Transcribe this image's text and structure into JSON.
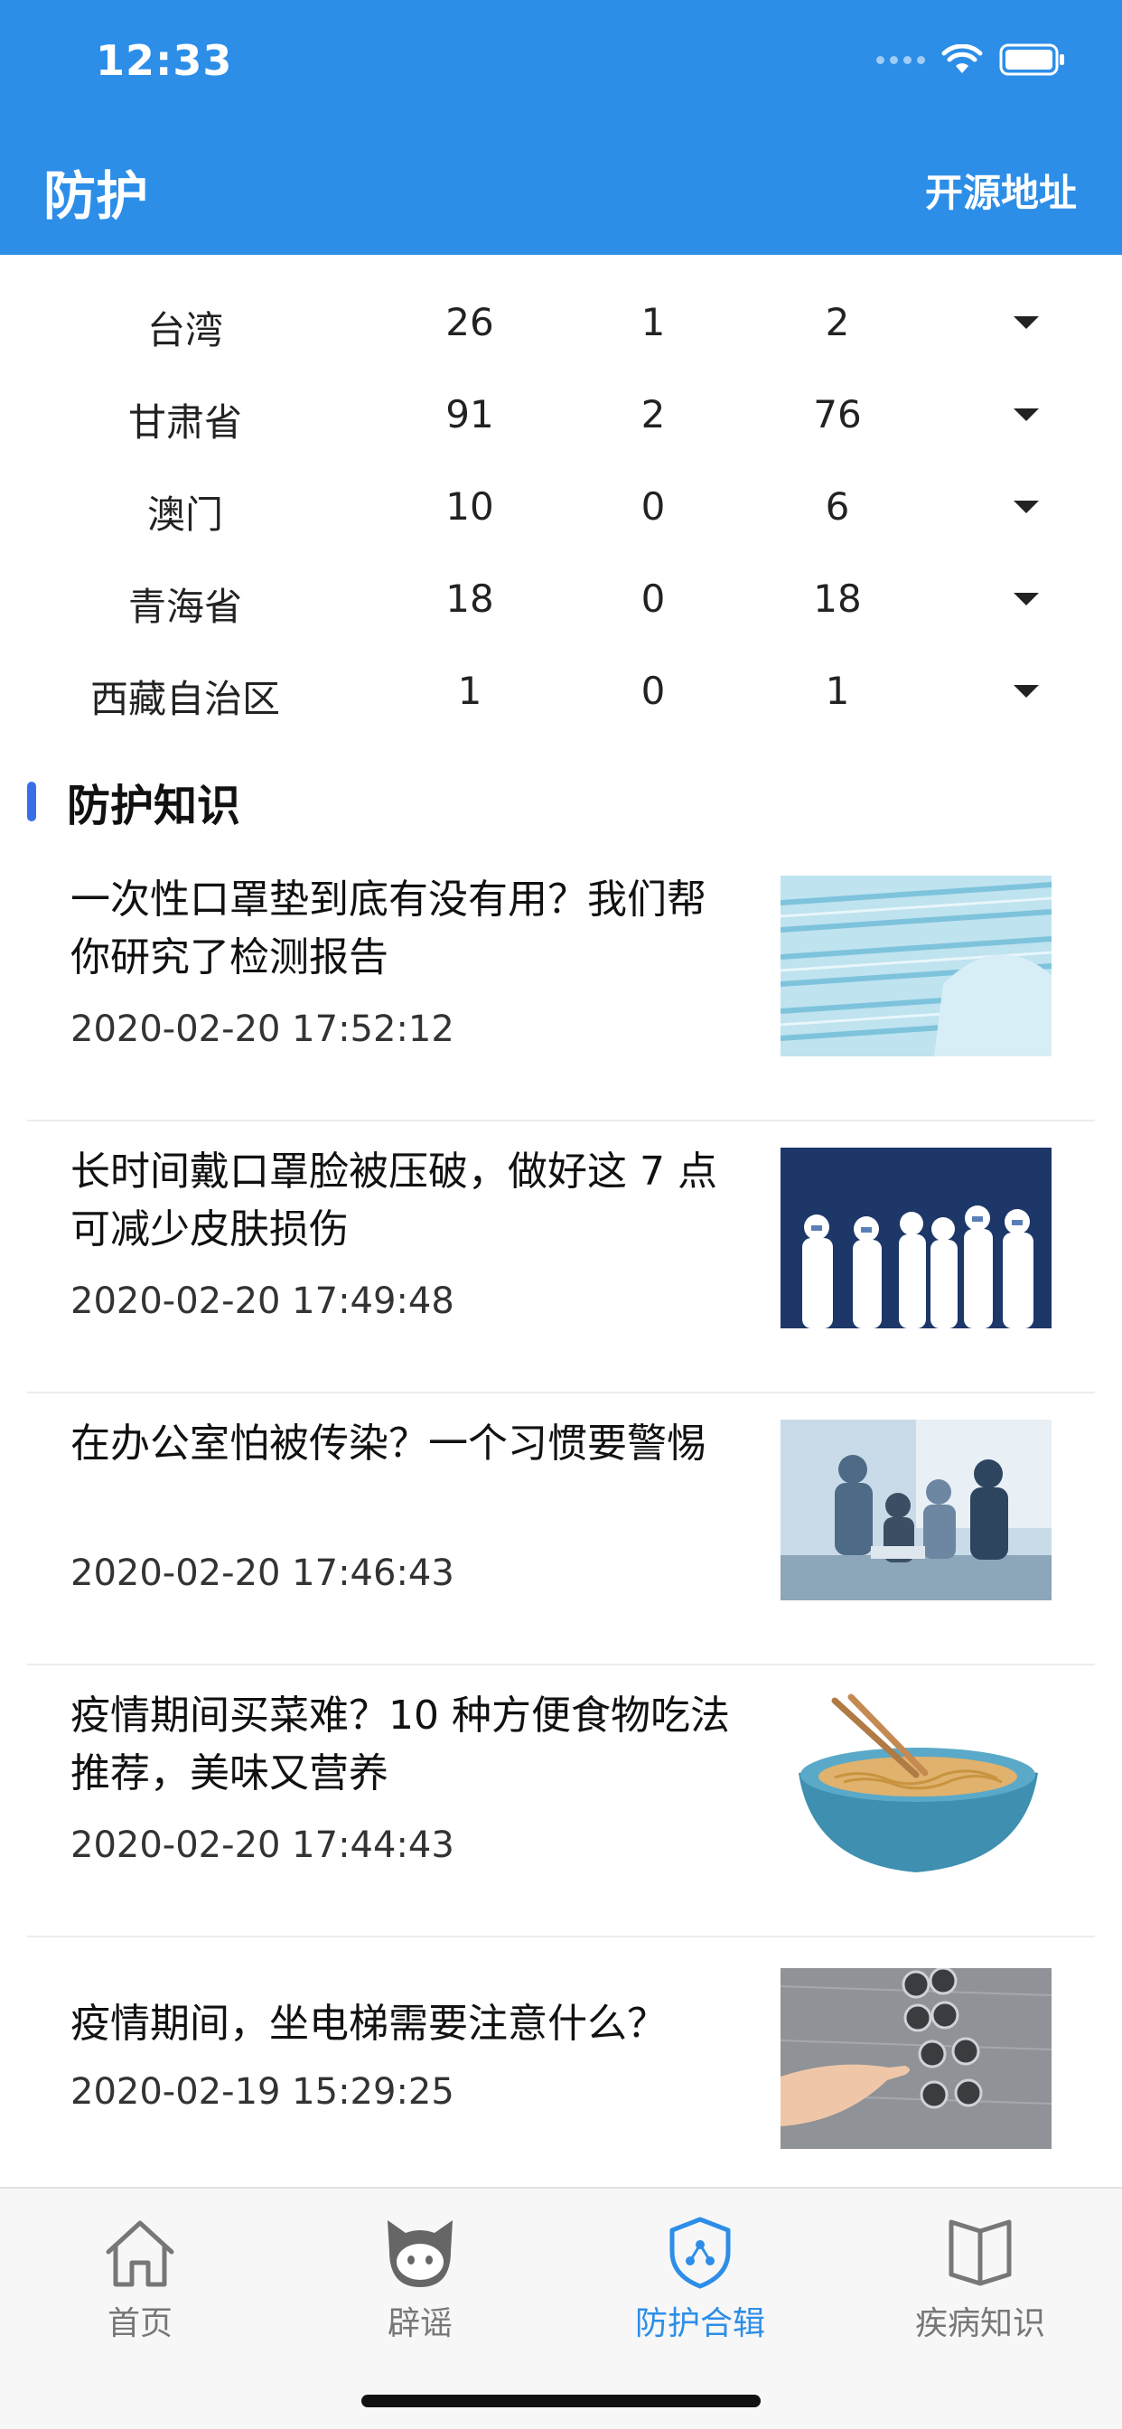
{
  "status": {
    "time": "12:33"
  },
  "header": {
    "title": "防护",
    "link_label": "开源地址"
  },
  "table": {
    "rows": [
      {
        "name": "台湾",
        "a": "26",
        "b": "1",
        "c": "2"
      },
      {
        "name": "甘肃省",
        "a": "91",
        "b": "2",
        "c": "76"
      },
      {
        "name": "澳门",
        "a": "10",
        "b": "0",
        "c": "6"
      },
      {
        "name": "青海省",
        "a": "18",
        "b": "0",
        "c": "18"
      },
      {
        "name": "西藏自治区",
        "a": "1",
        "b": "0",
        "c": "1"
      }
    ]
  },
  "section": {
    "title": "防护知识"
  },
  "articles": [
    {
      "title": "一次性口罩垫到底有没有用？我们帮你研究了检测报告",
      "time": "2020-02-20 17:52:12",
      "thumb": "masks-image"
    },
    {
      "title": "长时间戴口罩脸被压破，做好这 7 点可减少皮肤损伤",
      "time": "2020-02-20 17:49:48",
      "thumb": "medical-staff-image"
    },
    {
      "title": "在办公室怕被传染？一个习惯要警惕",
      "time": "2020-02-20 17:46:43",
      "thumb": "office-image"
    },
    {
      "title": "疫情期间买菜难？10 种方便食物吃法推荐，美味又营养",
      "time": "2020-02-20 17:44:43",
      "thumb": "noodles-image"
    },
    {
      "title": "疫情期间，坐电梯需要注意什么？",
      "time": "2020-02-19 15:29:25",
      "thumb": "elevator-image"
    }
  ],
  "tabs": [
    {
      "label": "首页",
      "icon": "home-icon",
      "active": false
    },
    {
      "label": "辟谣",
      "icon": "cat-mascot-icon",
      "active": false
    },
    {
      "label": "防护合辑",
      "icon": "shield-icon",
      "active": true
    },
    {
      "label": "疾病知识",
      "icon": "book-icon",
      "active": false
    }
  ],
  "colors": {
    "primary": "#2d8ee8",
    "section_bar": "#3a6ee8",
    "inactive_tab": "#777777"
  }
}
